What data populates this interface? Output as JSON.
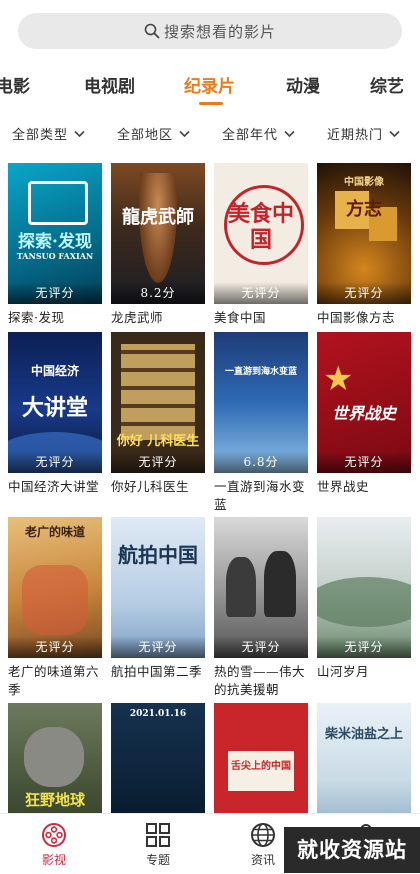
{
  "search": {
    "placeholder": "搜索想看的影片"
  },
  "tabs": [
    "电影",
    "电视剧",
    "纪录片",
    "动漫",
    "综艺"
  ],
  "active_tab": "纪录片",
  "filters": [
    "全部类型",
    "全部地区",
    "全部年代",
    "近期热门"
  ],
  "movies": [
    {
      "title": "探索·发现",
      "score": "无评分",
      "poster_text": "探索·发现",
      "poster_sub": "TANSUO  FAXIAN"
    },
    {
      "title": "龙虎武师",
      "score": "8.2分",
      "poster_text": "龍虎武師"
    },
    {
      "title": "美食中国",
      "score": "无评分",
      "poster_text": "美食中国"
    },
    {
      "title": "中国影像方志",
      "score": "无评分",
      "poster_text": "方志",
      "poster_sub": "中国影像"
    },
    {
      "title": "中国经济大讲堂",
      "score": "无评分",
      "poster_text": "大讲堂",
      "poster_sub": "中国经济"
    },
    {
      "title": "你好儿科医生",
      "score": "无评分",
      "poster_text": "你好 儿科医生"
    },
    {
      "title": "一直游到海水变蓝",
      "score": "6.8分",
      "poster_text": "一直游到海水变蓝"
    },
    {
      "title": "世界战史",
      "score": "无评分",
      "poster_text": "世界战史"
    },
    {
      "title": "老广的味道第六季",
      "score": "无评分",
      "poster_text": "老广的味道"
    },
    {
      "title": "航拍中国第二季",
      "score": "无评分",
      "poster_text": "航拍中国"
    },
    {
      "title": "热的雪——伟大的抗美援朝",
      "score": "无评分",
      "poster_text": ""
    },
    {
      "title": "山河岁月",
      "score": "无评分",
      "poster_text": ""
    },
    {
      "title": "",
      "score": "",
      "poster_text": "狂野地球"
    },
    {
      "title": "",
      "score": "",
      "poster_text": "2021.01.16"
    },
    {
      "title": "",
      "score": "",
      "poster_text": "舌尖上的中国"
    },
    {
      "title": "",
      "score": "",
      "poster_text": "柴米油盐之上"
    }
  ],
  "bottom_nav": [
    {
      "label": "影视",
      "icon": "film-reel-icon"
    },
    {
      "label": "专题",
      "icon": "grid-icon"
    },
    {
      "label": "资讯",
      "icon": "globe-icon"
    },
    {
      "label": "我的",
      "icon": "user-icon"
    }
  ],
  "watermark": "就收资源站",
  "colors": {
    "accent": "#f07a1a",
    "nav_active": "#d6283b"
  }
}
